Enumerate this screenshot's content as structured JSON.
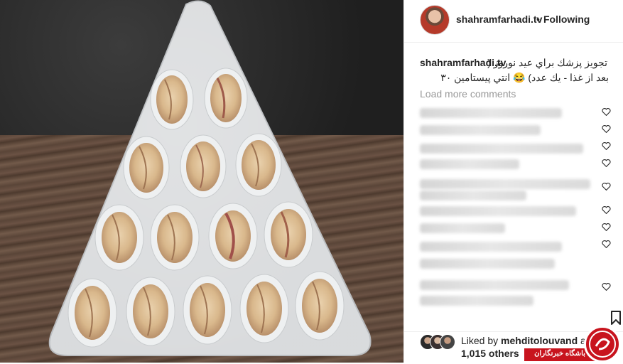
{
  "post": {
    "username": "shahramfarhadi.tv",
    "follow_separator": "•",
    "follow_status": "Following",
    "caption_user": "shahramfarhadi.tv",
    "caption_line1": "تجويز پزشك براي عيد نوروز (",
    "caption_line2": "بعد از غذا - يك عدد) 😂 انتي پيستامين ٣٠",
    "load_more": "Load more comments"
  },
  "likes": {
    "prefix": "Liked by ",
    "user": "mehditolouvand",
    "suffix": " and",
    "count": "1,015 others"
  },
  "watermark": {
    "text": "باشگاه خبرنگاران"
  },
  "icons": {
    "heart": "heart-icon",
    "bookmark": "bookmark-icon"
  },
  "colors": {
    "accent": "#c8141e",
    "muted": "#999999"
  }
}
